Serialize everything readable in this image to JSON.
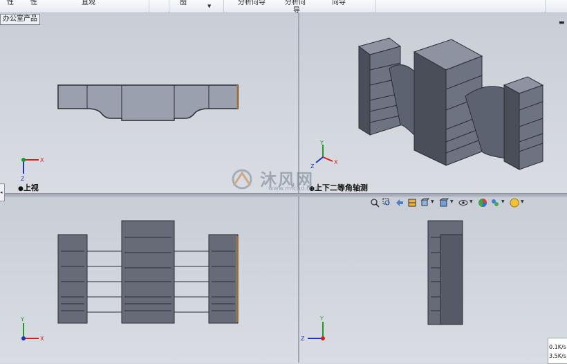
{
  "ribbon": {
    "items": [
      "性",
      "性",
      "直观",
      "图",
      "分析向导",
      "分析向",
      "向导"
    ],
    "item_line2": "导"
  },
  "tree_tab": "办公室产品",
  "viewports": {
    "top_left": {
      "label": "上视"
    },
    "top_right": {
      "label": "上下二等角轴测"
    },
    "bottom_left": {
      "label": ""
    },
    "bottom_right": {
      "label": ""
    }
  },
  "triad": {
    "x": "X",
    "y": "Y",
    "z": "Z"
  },
  "watermark": {
    "text": "沐风网",
    "url": "www.mfcad.com"
  },
  "net_speed": {
    "up": "0.1K/s",
    "down": "3.5K/s"
  },
  "icons": [
    "zoom-to-fit-icon",
    "zoom-area-icon",
    "previous-view-icon",
    "section-view-icon",
    "view-orientation-icon",
    "display-style-icon",
    "hide-show-items-icon",
    "edit-appearance-icon",
    "apply-scene-icon",
    "view-settings-icon"
  ],
  "colors": {
    "accent": "#d97c1e",
    "model": "#676b78",
    "model_dark": "#3b3e48",
    "triad_x": "#d42020",
    "triad_y": "#1c9a2a",
    "triad_z": "#2233bb"
  }
}
